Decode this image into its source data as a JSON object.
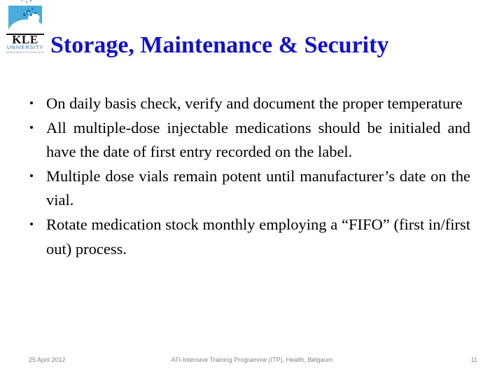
{
  "slide": {
    "background_color": "#FFFFFF",
    "title": "Storage, Maintenance & Security",
    "title_color": "#1111CC"
  },
  "logo": {
    "name": "kle-university-logo",
    "mark_color": "#49ACDB",
    "wordmark": "KLE",
    "wordmark_color": "#111111",
    "subtitle": "UNIVERSITY",
    "subtitle_color": "#2F6FA8",
    "tagline": "NURTURING  POTENTIALS"
  },
  "content": {
    "bullets": [
      "On daily basis check, verify and document the proper temperature",
      "All multiple-dose injectable medications should be initialed and have the date of first entry recorded on the label.",
      "Multiple dose vials remain potent until manufacturer’s date on the vial.",
      "Rotate medication stock monthly employing a “FIFO” (first in/first out) process."
    ],
    "bullet_glyph": "•",
    "text_color": "#000000"
  },
  "footer": {
    "date": "25 April 2012",
    "center": "ATI-Intensive Training Programme (ITP), Health,  Belgaum",
    "page_number": "11",
    "color": "#848484"
  }
}
